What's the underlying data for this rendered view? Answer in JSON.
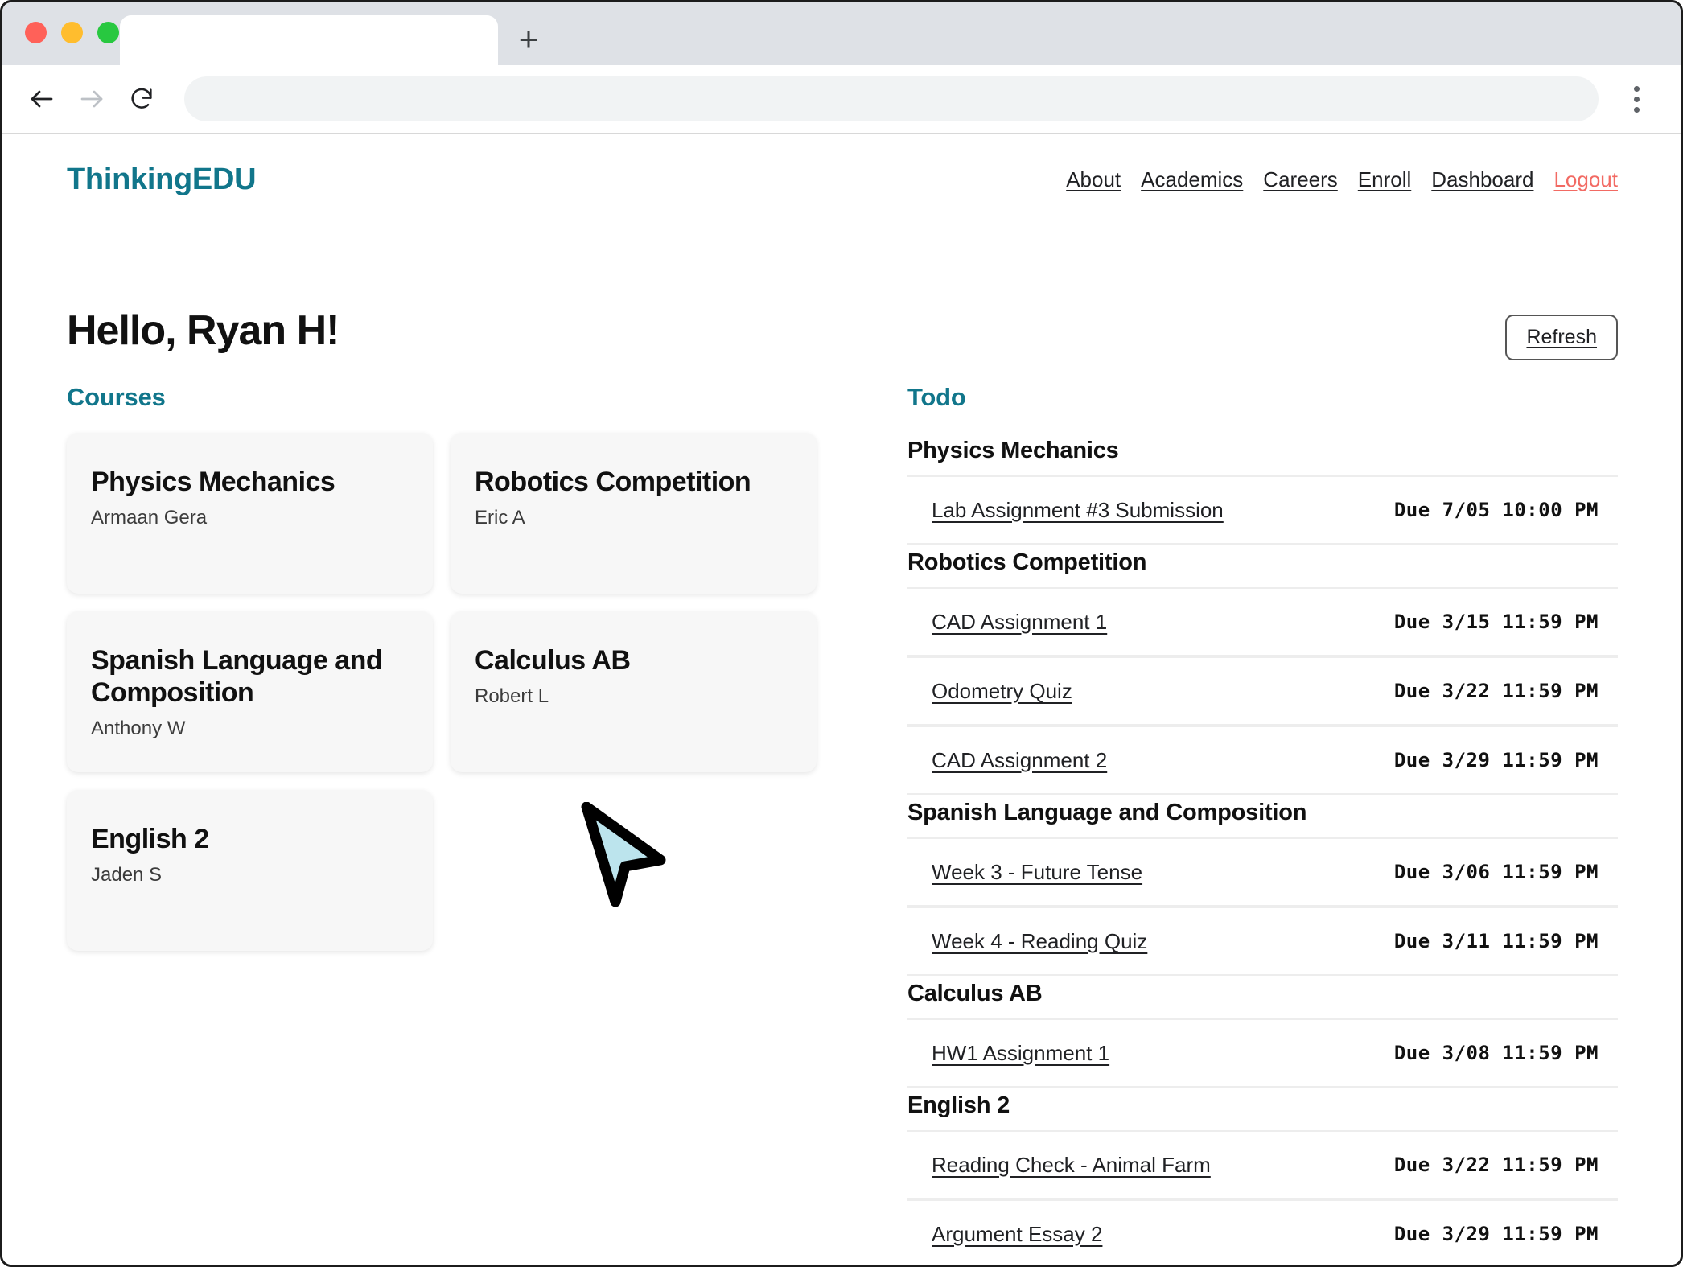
{
  "browser": {
    "tab_title": "",
    "new_tab_label": "+",
    "address_value": "",
    "address_placeholder": "",
    "back_icon": "back-arrow-icon",
    "forward_icon": "forward-arrow-icon",
    "reload_icon": "reload-icon",
    "menu_icon": "kebab-menu-icon"
  },
  "site": {
    "logo": "ThinkingEDU",
    "brand_color": "#11768b",
    "logout_color": "#f26a63",
    "nav": [
      {
        "label": "About"
      },
      {
        "label": "Academics"
      },
      {
        "label": "Careers"
      },
      {
        "label": "Enroll"
      },
      {
        "label": "Dashboard"
      },
      {
        "label": "Logout"
      }
    ]
  },
  "dashboard": {
    "greeting": "Hello, Ryan H!",
    "refresh_label": "Refresh",
    "courses_title": "Courses",
    "todo_title": "Todo"
  },
  "courses": [
    {
      "name": "Physics Mechanics",
      "teacher": "Armaan Gera"
    },
    {
      "name": "Robotics Competition",
      "teacher": "Eric A"
    },
    {
      "name": "Spanish Language and Composition",
      "teacher": "Anthony W"
    },
    {
      "name": "Calculus AB",
      "teacher": "Robert L"
    },
    {
      "name": "English 2",
      "teacher": "Jaden S"
    }
  ],
  "todo": [
    {
      "course": "Physics Mechanics",
      "items": [
        {
          "title": "Lab Assignment #3 Submission",
          "due": "Due 7/05 10:00 PM"
        }
      ]
    },
    {
      "course": "Robotics Competition",
      "items": [
        {
          "title": "CAD Assignment 1",
          "due": "Due 3/15 11:59 PM"
        },
        {
          "title": "Odometry Quiz",
          "due": "Due 3/22 11:59 PM"
        },
        {
          "title": "CAD Assignment 2",
          "due": "Due 3/29 11:59 PM"
        }
      ]
    },
    {
      "course": "Spanish Language and Composition",
      "items": [
        {
          "title": "Week 3 - Future Tense",
          "due": "Due 3/06 11:59 PM"
        },
        {
          "title": "Week 4 - Reading Quiz",
          "due": "Due 3/11 11:59 PM"
        }
      ]
    },
    {
      "course": "Calculus AB",
      "items": [
        {
          "title": "HW1 Assignment 1",
          "due": "Due 3/08 11:59 PM"
        }
      ]
    },
    {
      "course": "English 2",
      "items": [
        {
          "title": "Reading Check - Animal Farm",
          "due": "Due 3/22 11:59 PM"
        },
        {
          "title": "Argument Essay 2",
          "due": "Due 3/29 11:59 PM"
        }
      ]
    }
  ],
  "cursor": {
    "icon": "arrow-pointer-icon",
    "fill": "#bce4ed",
    "stroke": "#000000"
  }
}
